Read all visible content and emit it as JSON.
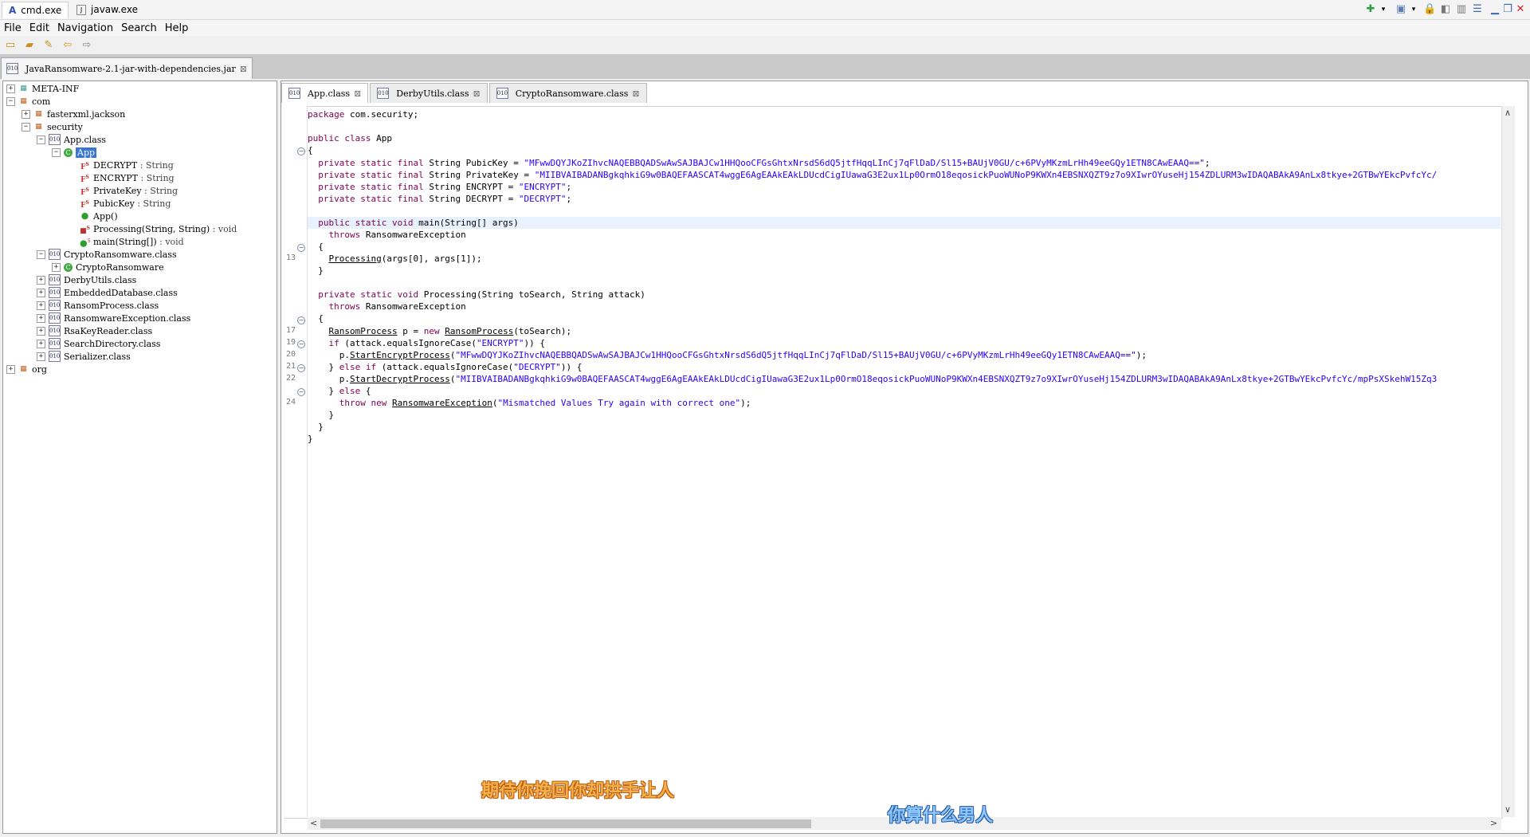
{
  "window_tabs": [
    {
      "label": "cmd.exe",
      "active": true
    },
    {
      "label": "javaw.exe",
      "active": false
    }
  ],
  "menu": [
    "File",
    "Edit",
    "Navigation",
    "Search",
    "Help"
  ],
  "jar_tab": {
    "label": "JavaRansomware-2.1-jar-with-dependencies.jar",
    "close": "⊠"
  },
  "tree": {
    "meta_inf": "META-INF",
    "com": "com",
    "fasterxml": "fasterxml.jackson",
    "security": "security",
    "app_class": "App.class",
    "app": "App",
    "fields": [
      {
        "name": "DECRYPT",
        "type": ": String"
      },
      {
        "name": "ENCRYPT",
        "type": ": String"
      },
      {
        "name": "PrivateKey",
        "type": ": String"
      },
      {
        "name": "PubicKey",
        "type": ": String"
      }
    ],
    "methods": [
      {
        "name": "App()",
        "type": ""
      },
      {
        "name": "Processing(String, String)",
        "type": ": void"
      },
      {
        "name": "main(String[])",
        "type": ": void"
      }
    ],
    "crypto_class": "CryptoRansomware.class",
    "crypto": "CryptoRansomware",
    "classes": [
      "DerbyUtils.class",
      "EmbeddedDatabase.class",
      "RansomProcess.class",
      "RansomwareException.class",
      "RsaKeyReader.class",
      "SearchDirectory.class",
      "Serializer.class"
    ],
    "org": "org"
  },
  "editor_tabs": [
    {
      "label": "App.class",
      "active": true
    },
    {
      "label": "DerbyUtils.class",
      "active": false
    },
    {
      "label": "CryptoRansomware.class",
      "active": false
    }
  ],
  "code": {
    "pubkey": "\"MFwwDQYJKoZIhvcNAQEBBQADSwAwSAJBAJCw1HHQooCFGsGhtxNrsdS6dQ5jtfHqqLInCj7qFlDaD/Sl15+BAUjV0GU/c+6PVyMKzmLrHh49eeGQy1ETN8CAwEAAQ==\"",
    "privkey": "\"MIIBVAIBADANBgkqhkiG9w0BAQEFAASCAT4wggE6AgEAAkEAkLDUcdCigIUawaG3E2ux1Lp0OrmO18eqosickPuoWUNoP9KWXn4EBSNXQZT9z7o9XIwrOYuseHj154ZDLURM3wIDAQABAkA9AnLx8tkye+2GTBwYEkcPvfcYc/",
    "privkey2": "\"MIIBVAIBADANBgkqhkiG9w0BAQEFAASCAT4wggE6AgEAAkEAkLDUcdCigIUawaG3E2ux1Lp0OrmO18eqosickPuoWUNoP9KWXn4EBSNXQZT9z7o9XIwrOYuseHj154ZDLURM3wIDAQABAkA9AnLx8tkye+2GTBwYEkcPvfcYc/mpPsXSkehW15Zq3",
    "encrypt": "\"ENCRYPT\"",
    "decrypt": "\"DECRYPT\"",
    "mismatch": "\"Mismatched Values Try again with correct one\""
  },
  "line_numbers": [
    "13",
    "17",
    "19",
    "20",
    "21",
    "22",
    "24"
  ],
  "subtitles": [
    "期待你挽回你却拱手让人",
    "你算什么男人"
  ]
}
